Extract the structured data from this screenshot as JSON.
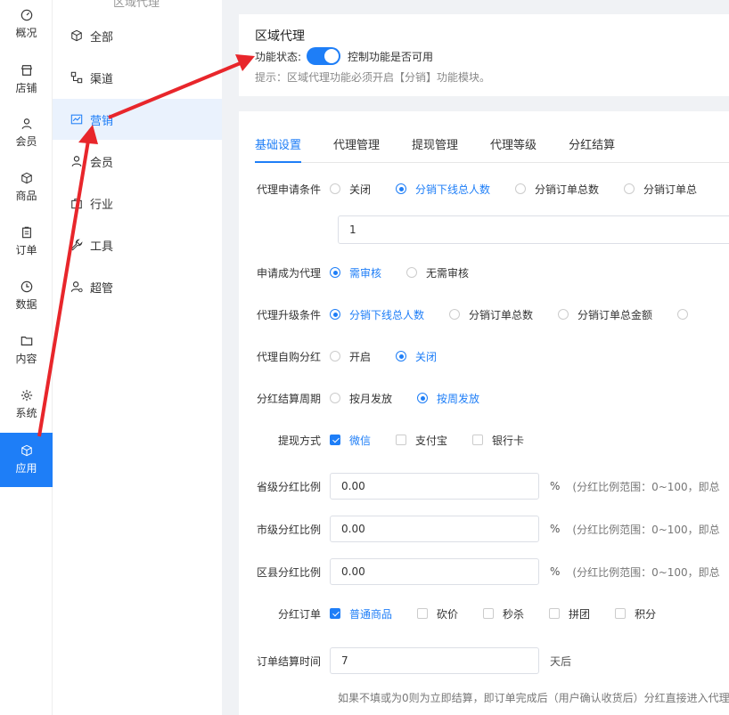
{
  "rail": [
    {
      "label": "概况",
      "icon": "gauge-icon"
    },
    {
      "label": "店铺",
      "icon": "store-icon"
    },
    {
      "label": "会员",
      "icon": "user-icon"
    },
    {
      "label": "商品",
      "icon": "box-icon"
    },
    {
      "label": "订单",
      "icon": "clipboard-icon"
    },
    {
      "label": "数据",
      "icon": "clock-icon"
    },
    {
      "label": "内容",
      "icon": "folder-icon"
    },
    {
      "label": "系统",
      "icon": "gear-icon"
    },
    {
      "label": "应用",
      "icon": "cube-icon",
      "active": true
    }
  ],
  "submenu": {
    "top_label": "区域代理",
    "items": [
      {
        "label": "全部",
        "icon": "cube-icon"
      },
      {
        "label": "渠道",
        "icon": "channel-icon"
      },
      {
        "label": "营销",
        "icon": "chart-icon",
        "active": true
      },
      {
        "label": "会员",
        "icon": "user-icon"
      },
      {
        "label": "行业",
        "icon": "bag-icon"
      },
      {
        "label": "工具",
        "icon": "wrench-icon"
      },
      {
        "label": "超管",
        "icon": "admin-icon"
      }
    ]
  },
  "header": {
    "title": "区域代理",
    "status_label": "功能状态:",
    "status_desc": "控制功能是否可用",
    "hint": "提示：区域代理功能必须开启【分销】功能模块。"
  },
  "tabs": [
    "基础设置",
    "代理管理",
    "提现管理",
    "代理等级",
    "分红结算"
  ],
  "form": {
    "apply_condition": {
      "label": "代理申请条件",
      "options": [
        "关闭",
        "分销下线总人数",
        "分销订单总数",
        "分销订单总"
      ],
      "value": "1"
    },
    "apply_review": {
      "label": "申请成为代理",
      "options": [
        "需审核",
        "无需审核"
      ]
    },
    "upgrade_condition": {
      "label": "代理升级条件",
      "options": [
        "分销下线总人数",
        "分销订单总数",
        "分销订单总金额"
      ]
    },
    "self_purchase": {
      "label": "代理自购分红",
      "options": [
        "开启",
        "关闭"
      ]
    },
    "settle_period": {
      "label": "分红结算周期",
      "options": [
        "按月发放",
        "按周发放"
      ]
    },
    "withdraw": {
      "label": "提现方式",
      "options": [
        "微信",
        "支付宝",
        "银行卡"
      ]
    },
    "province_ratio": {
      "label": "省级分红比例",
      "value": "0.00",
      "unit": "%",
      "range": "(分红比例范围：0~100，即总"
    },
    "city_ratio": {
      "label": "市级分红比例",
      "value": "0.00",
      "unit": "%",
      "range": "(分红比例范围：0~100，即总"
    },
    "county_ratio": {
      "label": "区县分红比例",
      "value": "0.00",
      "unit": "%",
      "range": "(分红比例范围：0~100，即总"
    },
    "dividend_orders": {
      "label": "分红订单",
      "options": [
        "普通商品",
        "砍价",
        "秒杀",
        "拼团",
        "积分"
      ]
    },
    "settle_time": {
      "label": "订单结算时间",
      "value": "7",
      "unit": "天后",
      "note": "如果不填或为0则为立即结算，即订单完成后（用户确认收货后）分红直接进入代理"
    }
  },
  "colors": {
    "accent": "#1e7ef7",
    "arrow": "#e8262b"
  }
}
